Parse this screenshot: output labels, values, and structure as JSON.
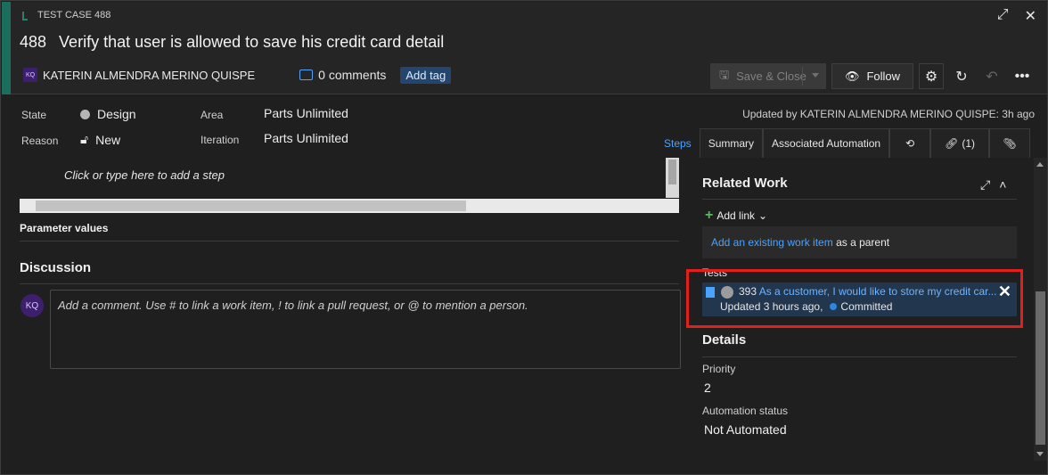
{
  "header": {
    "type_label": "TEST CASE 488",
    "id": "488",
    "title": "Verify that user is allowed to save his credit card detail",
    "author_initials": "KQ",
    "author": "KATERIN ALMENDRA MERINO QUISPE",
    "comments_count": "0 comments",
    "add_tag": "Add tag"
  },
  "toolbar": {
    "save_close": "Save & Close",
    "follow": "Follow"
  },
  "fields": {
    "state_label": "State",
    "state_value": "Design",
    "reason_label": "Reason",
    "reason_value": "New",
    "area_label": "Area",
    "area_value": "Parts Unlimited",
    "iteration_label": "Iteration",
    "iteration_value": "Parts Unlimited",
    "updated_by": "Updated by KATERIN ALMENDRA MERINO QUISPE: 3h ago"
  },
  "tabs": [
    {
      "label": "Steps"
    },
    {
      "label": "Summary"
    },
    {
      "label": "Associated Automation"
    },
    {
      "label": ""
    },
    {
      "label": "(1)"
    },
    {
      "label": ""
    }
  ],
  "steps": {
    "placeholder": "Click or type here to add a step",
    "parameter_values": "Parameter values"
  },
  "discussion": {
    "title": "Discussion",
    "avatar": "KQ",
    "placeholder": "Add a comment. Use # to link a work item, ! to link a pull request, or @ to mention a person."
  },
  "related_work": {
    "title": "Related Work",
    "add_link": "Add link",
    "parent_link": "Add an existing work item",
    "parent_suffix": " as a parent",
    "tests_label": "Tests",
    "test_item": {
      "id": "393",
      "title": "As a customer, I would like to store my credit car...",
      "updated": "Updated 3 hours ago,",
      "state": "Committed"
    }
  },
  "details": {
    "title": "Details",
    "priority_label": "Priority",
    "priority_value": "2",
    "automation_label": "Automation status",
    "automation_value": "Not Automated"
  },
  "colors": {
    "accent_bar": "#1b6e5b",
    "link": "#4aa3ff",
    "highlight": "#e41d1d",
    "committed_dot": "#2b87e3"
  }
}
